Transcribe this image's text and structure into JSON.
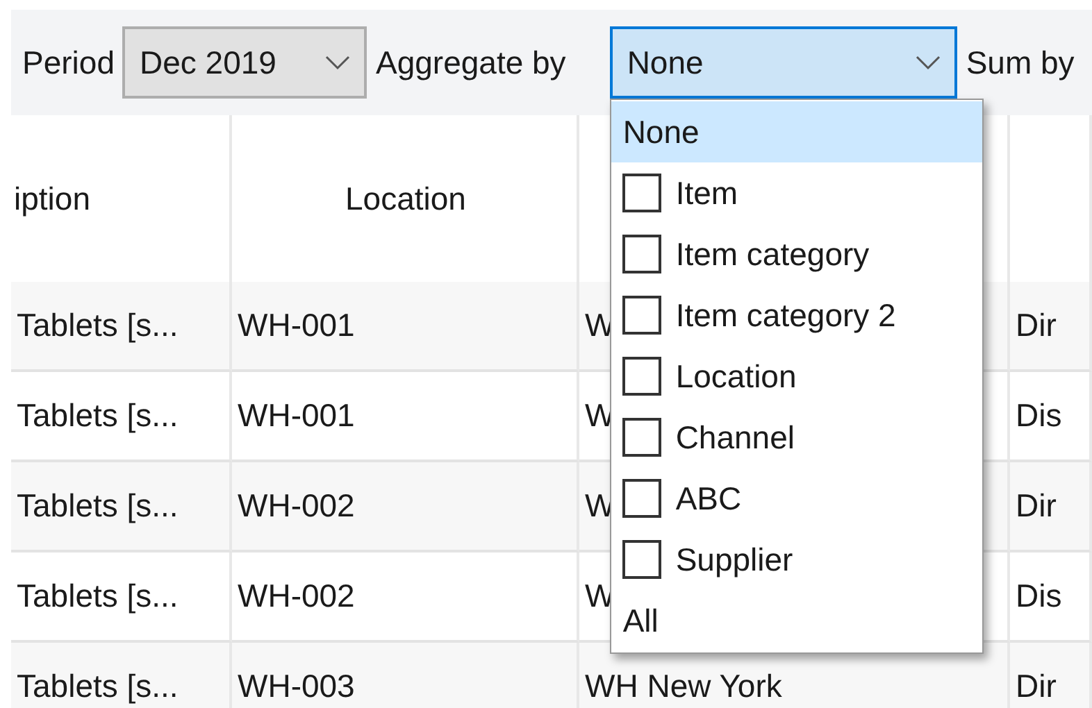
{
  "toolbar": {
    "period": {
      "label": "Period",
      "value": "Dec 2019",
      "expanded": false
    },
    "aggregate": {
      "label": "Aggregate by",
      "value": "None",
      "expanded": true
    },
    "sum": {
      "label": "Sum by"
    }
  },
  "table": {
    "columns": [
      "iption",
      "Location",
      "",
      ""
    ],
    "rows": [
      {
        "cells": [
          "Tablets [s...",
          "WH-001",
          "W",
          "Dir"
        ]
      },
      {
        "cells": [
          "Tablets [s...",
          "WH-001",
          "W",
          "Dis"
        ]
      },
      {
        "cells": [
          "Tablets [s...",
          "WH-002",
          "W",
          "Dir"
        ]
      },
      {
        "cells": [
          "Tablets [s...",
          "WH-002",
          "W",
          "Dis"
        ]
      },
      {
        "cells": [
          "Tablets [s...",
          "WH-003",
          "WH New York",
          "Dir"
        ]
      }
    ]
  },
  "dropdown": {
    "options": [
      {
        "label": "None",
        "kind": "plain",
        "selected": true
      },
      {
        "label": "Item",
        "kind": "check",
        "selected": false,
        "checked": false
      },
      {
        "label": "Item category",
        "kind": "check",
        "selected": false,
        "checked": false
      },
      {
        "label": "Item category 2",
        "kind": "check",
        "selected": false,
        "checked": false
      },
      {
        "label": "Location",
        "kind": "check",
        "selected": false,
        "checked": false
      },
      {
        "label": "Channel",
        "kind": "check",
        "selected": false,
        "checked": false
      },
      {
        "label": "ABC",
        "kind": "check",
        "selected": false,
        "checked": false
      },
      {
        "label": "Supplier",
        "kind": "check",
        "selected": false,
        "checked": false
      },
      {
        "label": "All",
        "kind": "plain",
        "selected": false
      }
    ]
  }
}
